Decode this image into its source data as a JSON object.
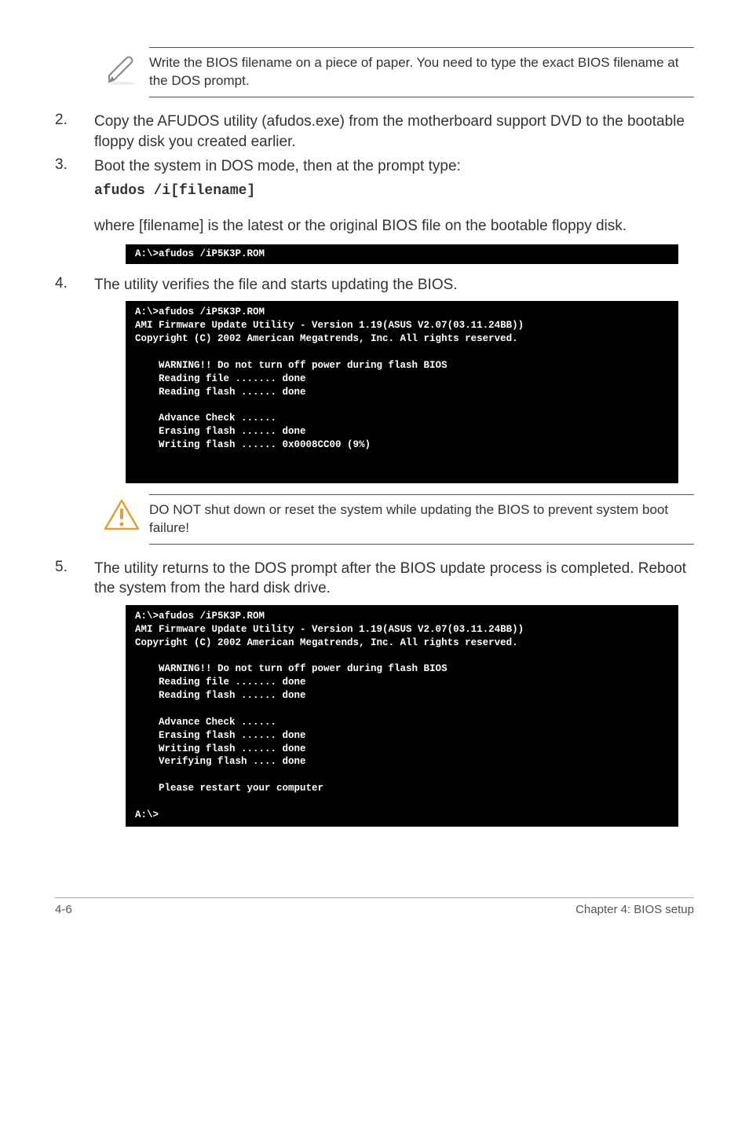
{
  "note1": "Write the BIOS filename on a piece of paper. You need to type the exact BIOS filename at the DOS prompt.",
  "steps": {
    "s2": {
      "num": "2.",
      "text": "Copy the AFUDOS utility (afudos.exe) from the motherboard support DVD to the bootable floppy disk you created earlier."
    },
    "s3": {
      "num": "3.",
      "text": "Boot the system in DOS mode, then at the prompt type:",
      "cmd": "afudos /i[filename]"
    },
    "s4": {
      "num": "4.",
      "text": "The utility verifies the file and starts updating the BIOS."
    },
    "s5": {
      "num": "5.",
      "text": "The utility returns to the DOS prompt after the BIOS update process is completed. Reboot the system from the hard disk drive."
    }
  },
  "sub3": "where [filename] is the latest or the original BIOS file on the bootable floppy disk.",
  "terminal1": "A:\\>afudos /iP5K3P.ROM",
  "terminal2": "A:\\>afudos /iP5K3P.ROM\nAMI Firmware Update Utility - Version 1.19(ASUS V2.07(03.11.24BB))\nCopyright (C) 2002 American Megatrends, Inc. All rights reserved.\n\n    WARNING!! Do not turn off power during flash BIOS\n    Reading file ....... done\n    Reading flash ...... done\n\n    Advance Check ......\n    Erasing flash ...... done\n    Writing flash ...... 0x0008CC00 (9%)\n\n\n",
  "warning": "DO NOT shut down or reset the system while updating the BIOS to prevent system boot failure!",
  "terminal3": "A:\\>afudos /iP5K3P.ROM\nAMI Firmware Update Utility - Version 1.19(ASUS V2.07(03.11.24BB))\nCopyright (C) 2002 American Megatrends, Inc. All rights reserved.\n\n    WARNING!! Do not turn off power during flash BIOS\n    Reading file ....... done\n    Reading flash ...... done\n\n    Advance Check ......\n    Erasing flash ...... done\n    Writing flash ...... done\n    Verifying flash .... done\n\n    Please restart your computer\n\nA:\\>",
  "footer": {
    "left": "4-6",
    "right": "Chapter 4: BIOS setup"
  }
}
